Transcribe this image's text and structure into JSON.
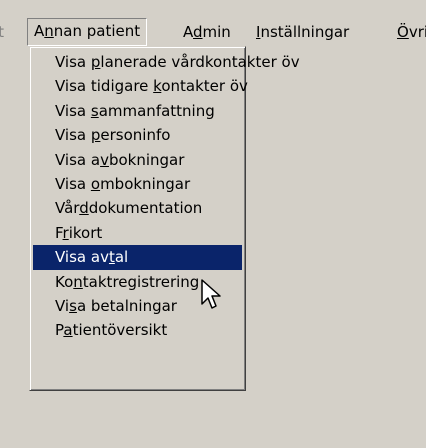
{
  "menubar": {
    "partial_left": "it",
    "items": [
      {
        "label": "Annan patient",
        "underline": "n",
        "active": true
      },
      {
        "label": "Admin",
        "underline": "d"
      },
      {
        "label": "Inställningar",
        "underline": "I"
      },
      {
        "label": "Övrig",
        "underline": "Ö"
      }
    ]
  },
  "dropdown": {
    "items": [
      {
        "label": "Visa planerade vårdkontakter öv"
      },
      {
        "label": "Visa tidigare kontakter öv"
      },
      {
        "label": "Visa sammanfattning"
      },
      {
        "label": "Visa personinfo"
      },
      {
        "label": "Visa avbokningar"
      },
      {
        "label": "Visa ombokningar"
      },
      {
        "label": "Vårddokumentation"
      },
      {
        "label": "Frikort"
      },
      {
        "label": "Visa avtal",
        "selected": true
      },
      {
        "label": "Kontaktregistrering"
      },
      {
        "label": "Visa betalningar"
      },
      {
        "label": "Patientöversikt"
      }
    ]
  },
  "colors": {
    "menu_bg": "#d4d0c8",
    "highlight_bg": "#0a246a",
    "highlight_text": "#ffffff"
  },
  "cursor_icon": "arrow-pointer-icon"
}
